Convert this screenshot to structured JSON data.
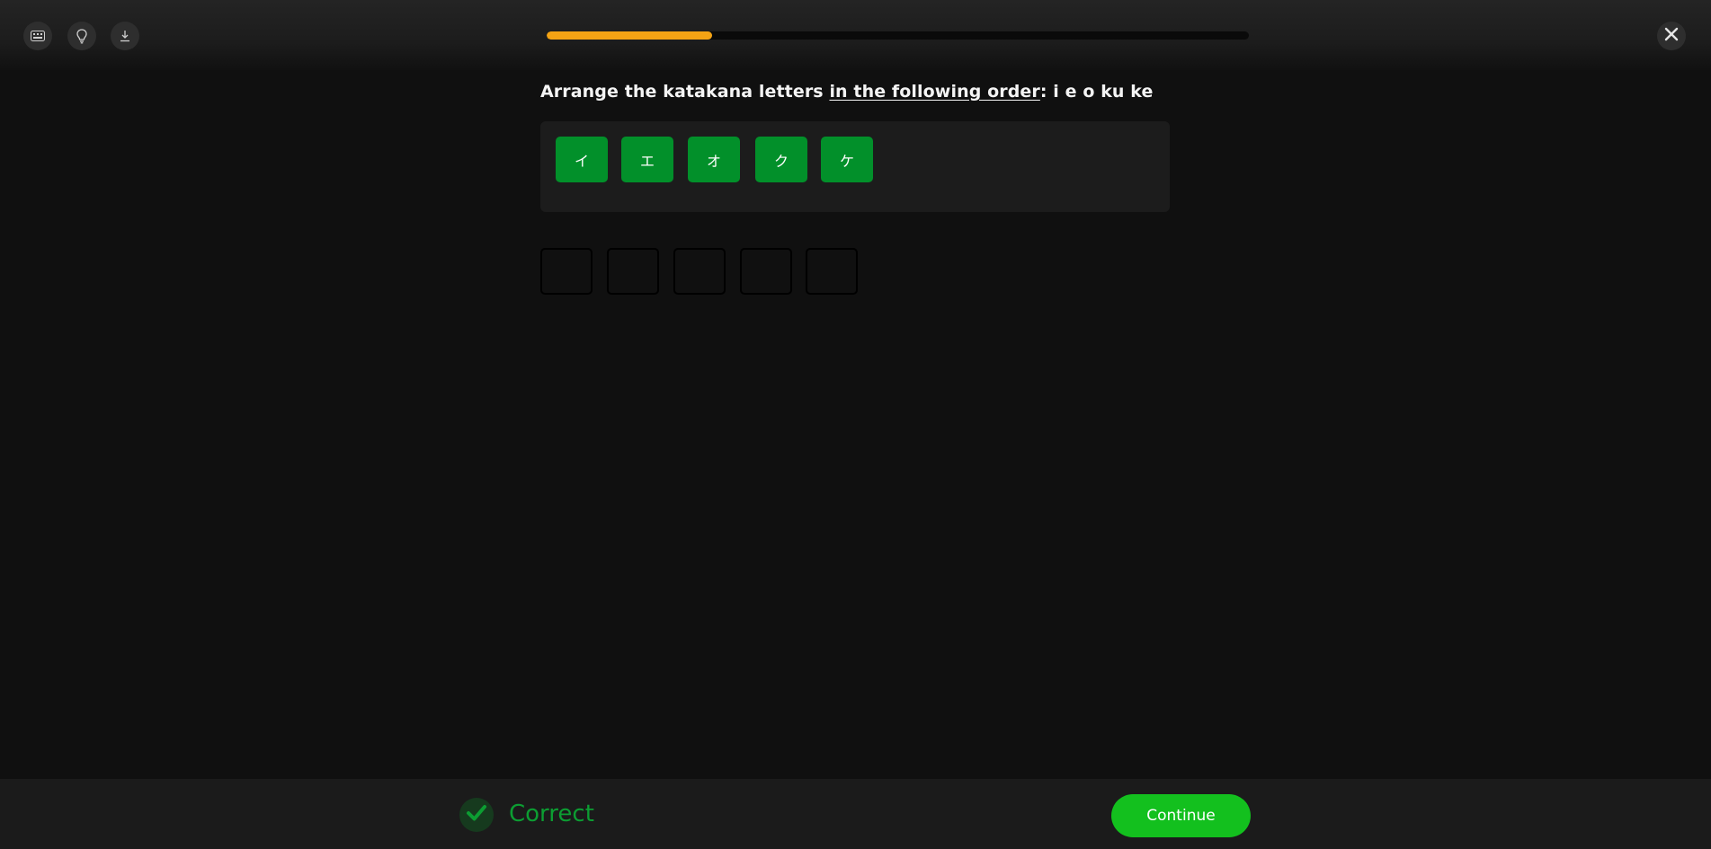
{
  "toolbar": {
    "icons": [
      "keyboard-icon",
      "lightbulb-icon",
      "download-icon"
    ],
    "close_icon": "close-icon"
  },
  "progress": {
    "fraction": 0.235,
    "color": "#f4a314"
  },
  "exercise": {
    "prompt_start": "Arrange the katakana letters ",
    "prompt_emphasis": "in the following order",
    "prompt_end": ": i e o ku ke",
    "tiles": [
      "イ",
      "エ",
      "オ",
      "ク",
      "ケ"
    ],
    "answer_slots": [
      "",
      "",
      "",
      "",
      ""
    ]
  },
  "feedback": {
    "status_icon": "check-icon",
    "status_text": "Correct",
    "continue_label": "Continue",
    "accent_color": "#13c01e"
  }
}
